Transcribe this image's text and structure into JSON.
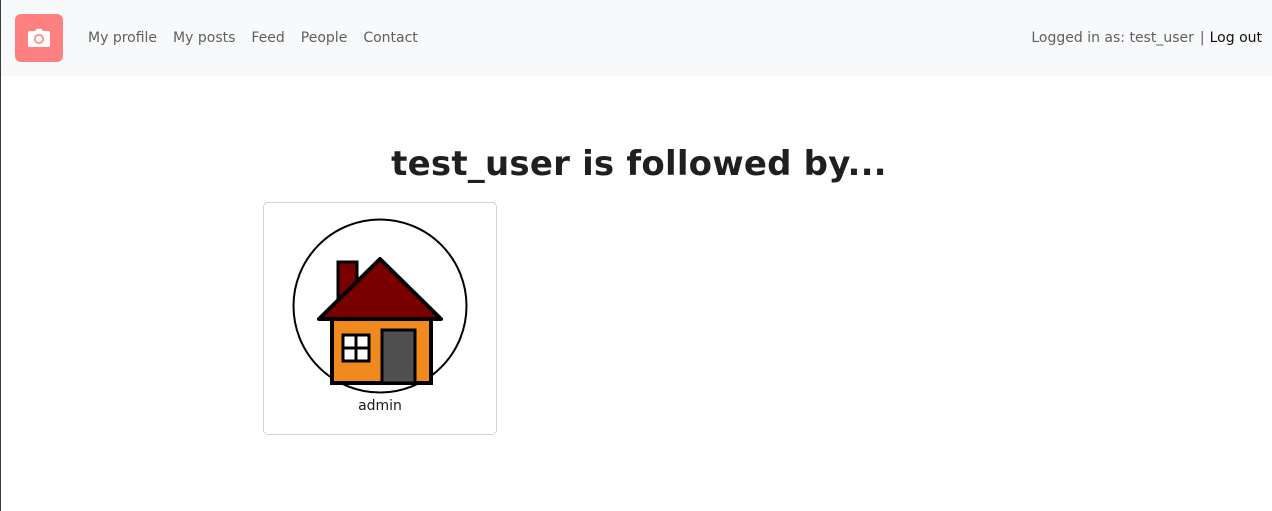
{
  "navbar": {
    "brand_icon": "camera-icon",
    "brand_color": "#ff8080",
    "links": [
      "My profile",
      "My posts",
      "Feed",
      "People",
      "Contact"
    ],
    "logged_in_label": "Logged in as: test_user",
    "separator": "|",
    "logout_label": "Log out"
  },
  "main": {
    "heading": "test_user is followed by...",
    "followers": [
      {
        "username": "admin",
        "avatar_icon": "house-icon"
      }
    ]
  }
}
